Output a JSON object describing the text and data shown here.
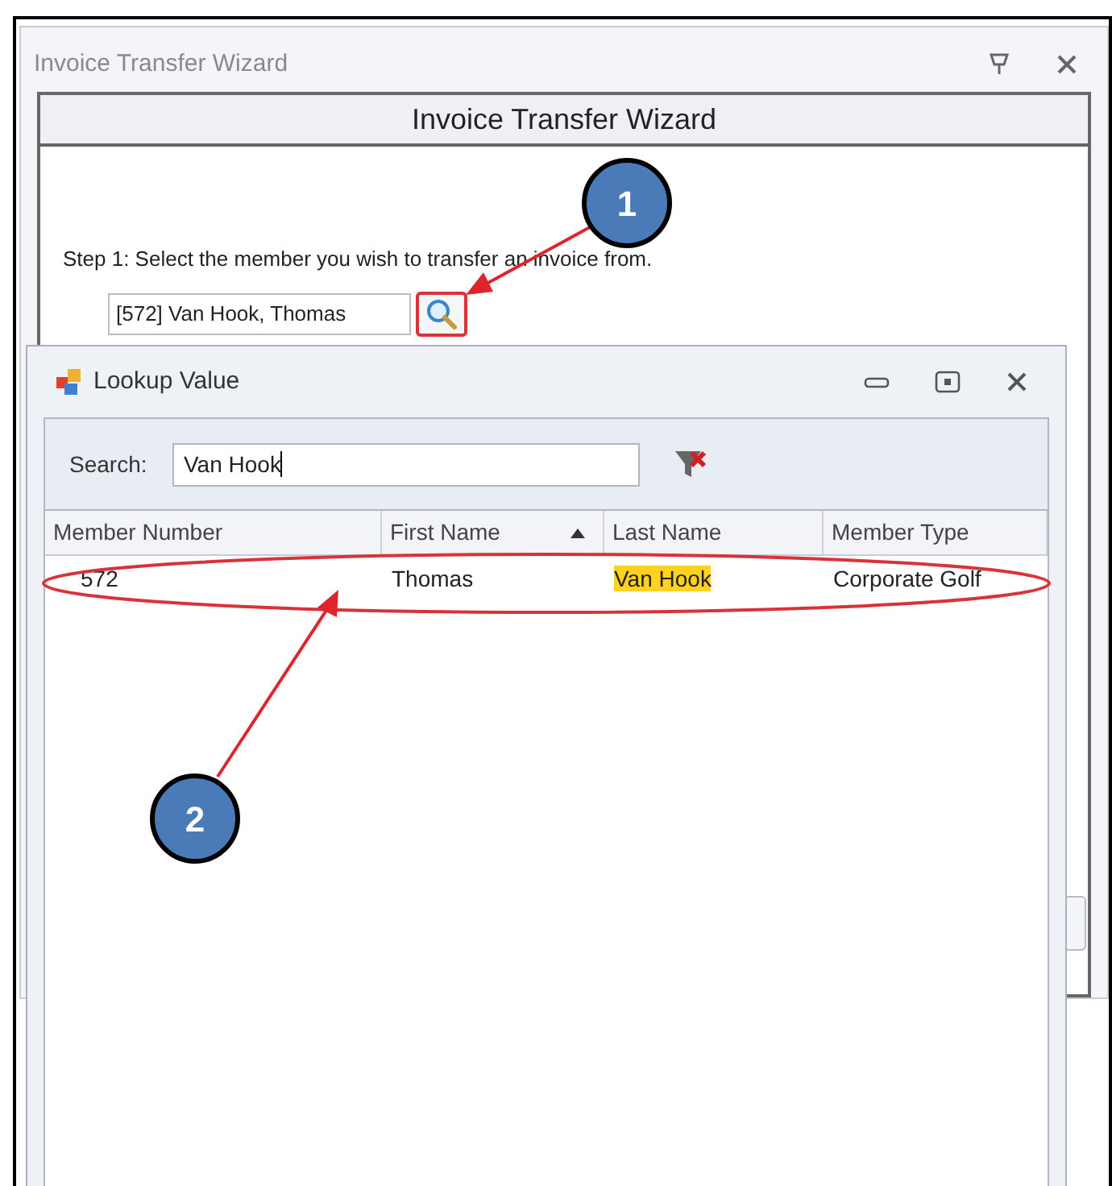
{
  "wizard": {
    "title": "Invoice Transfer Wizard",
    "header": "Invoice Transfer Wizard",
    "step_text": "Step 1:  Select the member you wish to transfer an invoice from.",
    "member_field": {
      "value": "[572] Van Hook, Thomas"
    }
  },
  "lookup_dialog": {
    "title": "Lookup Value",
    "search": {
      "label": "Search:",
      "value": "Van Hook"
    },
    "table": {
      "columns": [
        {
          "label": "Member Number",
          "sorted": false
        },
        {
          "label": "First Name",
          "sorted": true
        },
        {
          "label": "Last Name",
          "sorted": false
        },
        {
          "label": "Member Type",
          "sorted": false
        }
      ],
      "rows": [
        {
          "cells": [
            {
              "text": "572",
              "highlighted": false
            },
            {
              "text": "Thomas",
              "highlighted": false
            },
            {
              "text": "Van Hook",
              "highlighted": true
            },
            {
              "text": "Corporate Golf",
              "highlighted": false
            }
          ]
        }
      ]
    }
  },
  "callouts": [
    {
      "label": "1"
    },
    {
      "label": "2"
    }
  ]
}
